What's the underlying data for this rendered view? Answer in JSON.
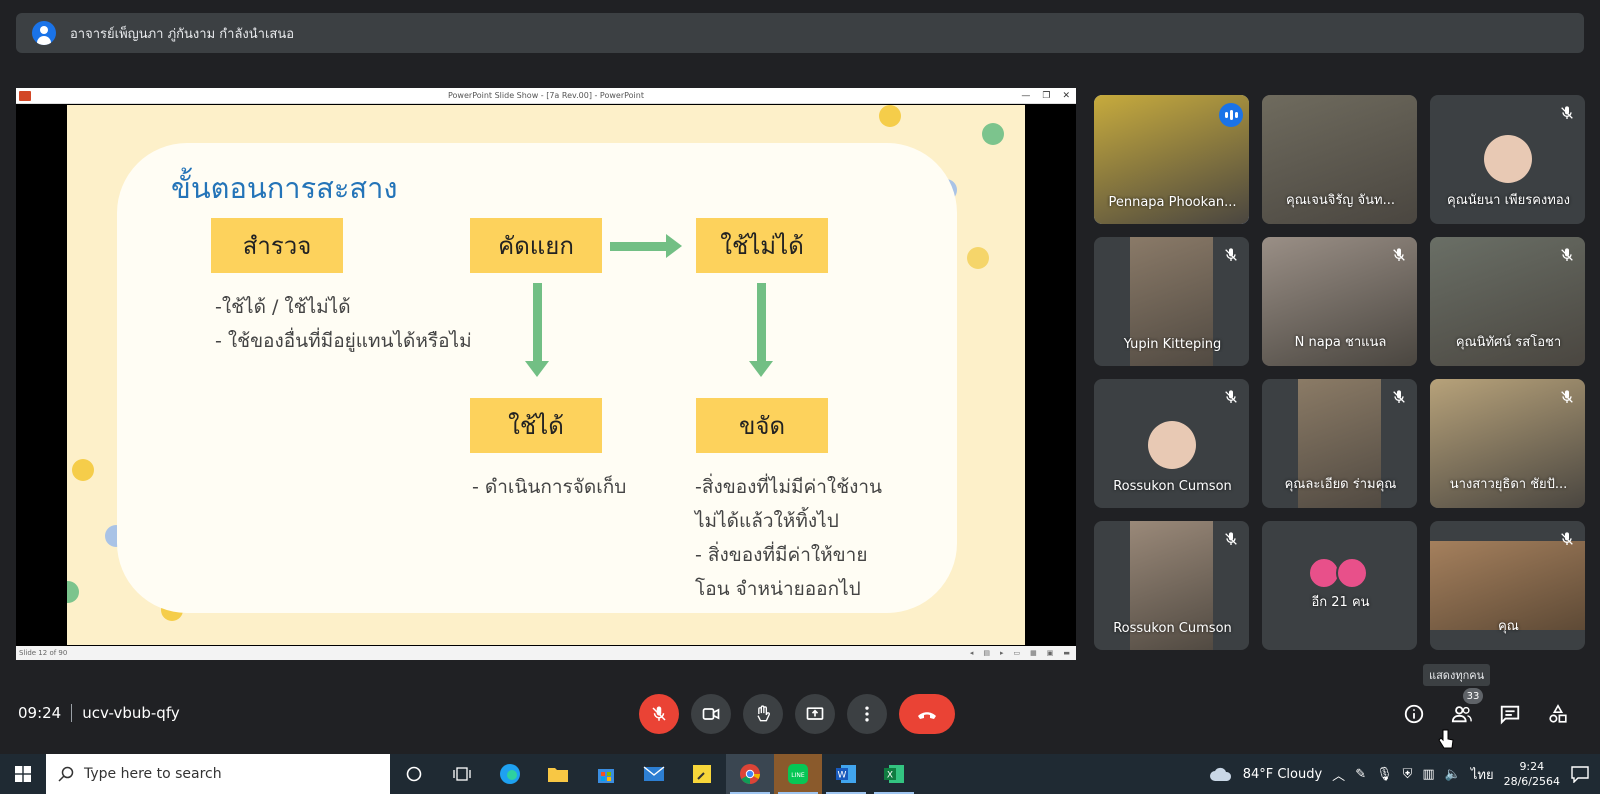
{
  "banner": {
    "text": "อาจารย์เพ็ญนภา ภู่กันงาม กำลังนำเสนอ"
  },
  "presentation": {
    "window_title": "PowerPoint Slide Show - [7a Rev.00] - PowerPoint",
    "status": "Slide 12 of 90",
    "slide": {
      "title": "ขั้นตอนการสะสาง",
      "box_survey": "สำรวจ",
      "box_sort": "คัดแยก",
      "box_unusable": "ใช้ไม่ได้",
      "box_usable": "ใช้ได้",
      "box_dispose": "ขจัด",
      "survey_text": "-ใช้ได้ / ใช้ไม่ได้\n- ใช้ของอื่นที่มีอยู่แทนได้หรือไม่",
      "usable_text": "- ดำเนินการจัดเก็บ",
      "dispose_text": "-สิ่งของที่ไม่มีค่าใช้งาน\nไม่ได้แล้วให้ทิ้งไป\n- สิ่งของที่มีค่าให้ขาย\nโอน จำหน่ายออกไป"
    }
  },
  "participants": [
    {
      "name": "Pennapa Phookan...",
      "muted": false,
      "speaking": true,
      "type": "cam",
      "bg": "#c7ab3d"
    },
    {
      "name": "คุณเจนจิรัญ จันท...",
      "muted": false,
      "speaking": false,
      "type": "cam",
      "bg": "#6f6b5e"
    },
    {
      "name": "คุณนัยนา เพียรคงทอง",
      "muted": true,
      "speaking": false,
      "type": "avatar",
      "bg": "#3c4043"
    },
    {
      "name": "Yupin Kitteping",
      "muted": true,
      "speaking": false,
      "type": "cam-narrow",
      "bg": "#8a7a68"
    },
    {
      "name": "N napa ชาแนล",
      "muted": true,
      "speaking": false,
      "type": "cam",
      "bg": "#9a8f86"
    },
    {
      "name": "คุณนิทัศน์ รสโอชา",
      "muted": true,
      "speaking": false,
      "type": "cam",
      "bg": "#6a6f66"
    },
    {
      "name": "Rossukon Cumson",
      "muted": true,
      "speaking": false,
      "type": "avatar",
      "bg": "#3c4043"
    },
    {
      "name": "คุณละเอียด ร่ามคุณ",
      "muted": true,
      "speaking": false,
      "type": "cam-narrow",
      "bg": "#8b7b66"
    },
    {
      "name": "นางสาวยุธิดา ชัยปั...",
      "muted": true,
      "speaking": false,
      "type": "cam",
      "bg": "#b7a27a"
    },
    {
      "name": "Rossukon Cumson",
      "muted": true,
      "speaking": false,
      "type": "cam-narrow",
      "bg": "#9a8979"
    },
    {
      "name": "อีก 21 คน",
      "muted": false,
      "speaking": false,
      "type": "more",
      "bg": "#3c4043"
    },
    {
      "name": "คุณ",
      "muted": true,
      "speaking": false,
      "type": "cam-low",
      "bg": "#a5805d"
    }
  ],
  "meeting": {
    "time": "09:24",
    "code": "ucv-vbub-qfy",
    "people_count": "33",
    "tooltip": "แสดงทุกคน"
  },
  "taskbar": {
    "search_placeholder": "Type here to search",
    "weather": "84°F  Cloudy",
    "lang": "ไทย",
    "time": "9:24",
    "date": "28/6/2564"
  }
}
